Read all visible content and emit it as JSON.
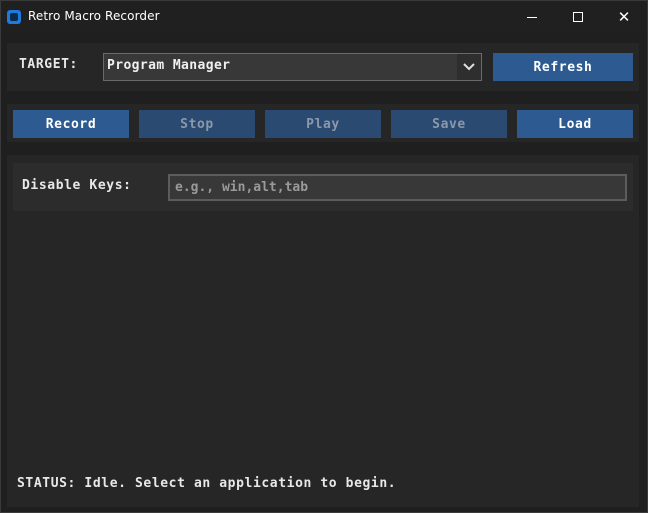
{
  "window": {
    "title": "Retro Macro Recorder",
    "controls": {
      "minimize": "minimize-icon",
      "maximize": "maximize-icon",
      "close": "close-icon"
    }
  },
  "target": {
    "label": "TARGET:",
    "selected": "Program Manager",
    "refresh_label": "Refresh"
  },
  "toolbar": {
    "buttons": [
      {
        "label": "Record",
        "enabled": true
      },
      {
        "label": "Stop",
        "enabled": false
      },
      {
        "label": "Play",
        "enabled": false
      },
      {
        "label": "Save",
        "enabled": false
      },
      {
        "label": "Load",
        "enabled": true
      }
    ]
  },
  "disable_keys": {
    "label": "Disable Keys:",
    "value": "",
    "placeholder": "e.g., win,alt,tab"
  },
  "status": {
    "text": "STATUS: Idle. Select an application to begin."
  },
  "colors": {
    "accent_button": "#2d5b91",
    "disabled_button": "#2a4a72",
    "background": "#1f1f1f",
    "panel": "#262626",
    "app_icon": "#1e7ae0"
  }
}
